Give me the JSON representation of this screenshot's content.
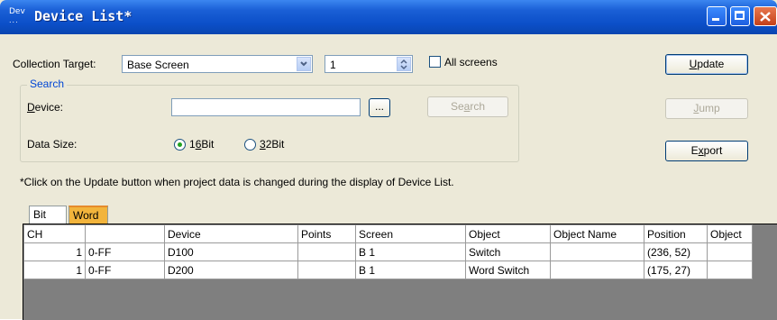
{
  "window": {
    "icon_top": "Dev",
    "icon_bottom": "...",
    "title": "Device List*"
  },
  "collection": {
    "label": "Collection Target:",
    "target_value": "Base Screen",
    "screen_number": "1",
    "all_screens_label": "All screens",
    "all_screens_checked": false
  },
  "search": {
    "group_title": "Search",
    "device_label": "Device:",
    "device_value": "",
    "browse_label": "...",
    "search_button_label": "Search",
    "data_size_label": "Data Size:",
    "option_16bit": "16Bit",
    "option_32bit": "32Bit",
    "selected": "16Bit"
  },
  "buttons": {
    "update": "Update",
    "jump": "Jump",
    "export": "Export"
  },
  "note": "*Click on the Update button when project data is changed during the display of Device List.",
  "tabs": [
    {
      "label": "Bit",
      "active": false
    },
    {
      "label": "Word",
      "active": true
    }
  ],
  "table": {
    "columns": [
      "CH",
      "",
      "Device",
      "Points",
      "Screen",
      "Object",
      "Object Name",
      "Position",
      "Object"
    ],
    "rows": [
      [
        "1",
        "0-FF",
        "D100",
        "",
        "B 1",
        "Switch",
        "",
        "(236, 52)",
        ""
      ],
      [
        "1",
        "0-FF",
        "D200",
        "",
        "B 1",
        "Word Switch",
        "",
        "(175, 27)",
        ""
      ]
    ]
  },
  "colors": {
    "titlebar": "#0b4fc8",
    "active_tab": "#f2b43c",
    "grid_empty": "#7f7f7f"
  }
}
